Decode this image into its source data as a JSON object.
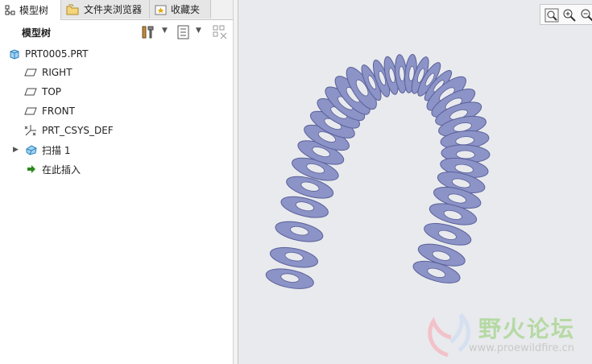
{
  "tabs": [
    {
      "label": "模型树",
      "icon": "model-tree-icon",
      "active": true
    },
    {
      "label": "文件夹浏览器",
      "icon": "folder-browser-icon",
      "active": false
    },
    {
      "label": "收藏夹",
      "icon": "favorites-icon",
      "active": false
    }
  ],
  "toolbar": {
    "title": "模型树",
    "buttons": [
      "settings-tools-icon",
      "show-options-icon",
      "filter-icon"
    ]
  },
  "tree": {
    "root": {
      "label": "PRT0005.PRT",
      "icon": "part-icon"
    },
    "items": [
      {
        "label": "RIGHT",
        "icon": "datum-plane-icon"
      },
      {
        "label": "TOP",
        "icon": "datum-plane-icon"
      },
      {
        "label": "FRONT",
        "icon": "datum-plane-icon"
      },
      {
        "label": "PRT_CSYS_DEF",
        "icon": "coordinate-system-icon"
      },
      {
        "label": "扫描 1",
        "icon": "sweep-feature-icon",
        "expandable": true
      },
      {
        "label": "在此插入",
        "icon": "insert-here-arrow-icon"
      }
    ]
  },
  "view_tools": [
    "zoom-fit-icon",
    "zoom-in-icon",
    "zoom-out-icon"
  ],
  "watermark": {
    "name": "野火论坛",
    "url": "www.proewildfire.cn"
  },
  "colors": {
    "spring_fill": "#8c93c7",
    "spring_shade": "#5a6099",
    "viewport_bg": "#e8eaed",
    "insert_arrow": "#2d8a1e",
    "watermark_text": "#b6d9a4"
  }
}
